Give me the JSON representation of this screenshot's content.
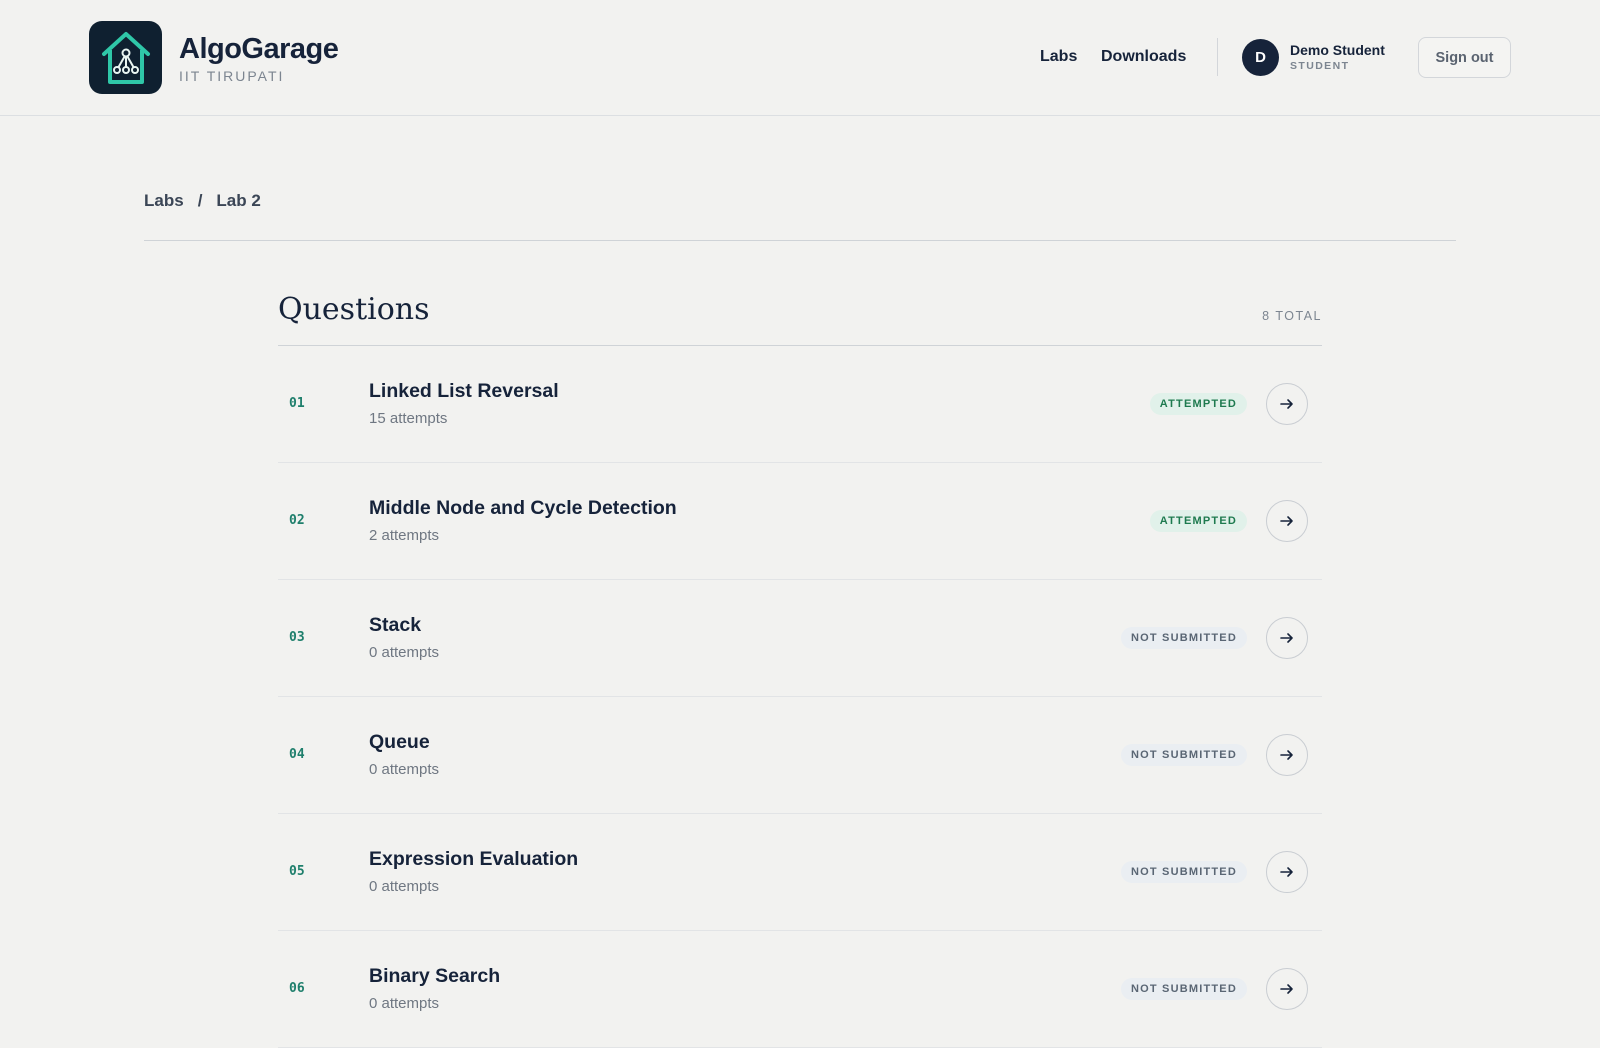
{
  "brand": {
    "name": "AlgoGarage",
    "subtitle": "IIT TIRUPATI",
    "logo_icon": "house-tree-icon"
  },
  "nav": {
    "labs": "Labs",
    "downloads": "Downloads"
  },
  "user": {
    "initial": "D",
    "name": "Demo Student",
    "role": "STUDENT",
    "signout": "Sign out"
  },
  "breadcrumb": {
    "root": "Labs",
    "separator": "/",
    "current": "Lab 2"
  },
  "questions": {
    "title": "Questions",
    "total": "8 TOTAL",
    "items": [
      {
        "num": "01",
        "name": "Linked List Reversal",
        "attempts": "15 attempts",
        "status": "ATTEMPTED",
        "state": "attempted"
      },
      {
        "num": "02",
        "name": "Middle Node and Cycle Detection",
        "attempts": "2 attempts",
        "status": "ATTEMPTED",
        "state": "attempted"
      },
      {
        "num": "03",
        "name": "Stack",
        "attempts": "0 attempts",
        "status": "NOT SUBMITTED",
        "state": "pending"
      },
      {
        "num": "04",
        "name": "Queue",
        "attempts": "0 attempts",
        "status": "NOT SUBMITTED",
        "state": "pending"
      },
      {
        "num": "05",
        "name": "Expression Evaluation",
        "attempts": "0 attempts",
        "status": "NOT SUBMITTED",
        "state": "pending"
      },
      {
        "num": "06",
        "name": "Binary Search",
        "attempts": "0 attempts",
        "status": "NOT SUBMITTED",
        "state": "pending"
      }
    ]
  },
  "colors": {
    "accent": "#2fc7a8",
    "dark": "#16233a",
    "attempted": "#1e7a4f"
  }
}
